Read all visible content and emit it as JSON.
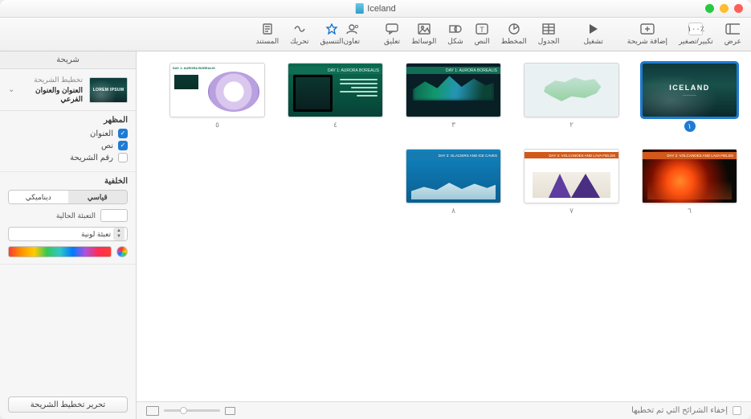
{
  "document": {
    "title": "Iceland"
  },
  "toolbar": {
    "view": "عرض",
    "zoom": "تكبير/تصغير",
    "zoom_value": "٪١٠٠",
    "add_slide": "إضافة شريحة",
    "play": "تشغيل",
    "table": "الجدول",
    "chart": "المخطط",
    "text": "النص",
    "shape": "شكل",
    "media": "الوسائط",
    "comment": "تعليق",
    "collaborate": "تعاون",
    "format": "التنسيق",
    "animate": "تحريك",
    "document_tab": "المستند"
  },
  "slides": [
    {
      "num": "١",
      "title": "ICELAND",
      "variant": "iceland",
      "selected": true
    },
    {
      "num": "٢",
      "variant": "map"
    },
    {
      "num": "٣",
      "title": "DAY 1: AURORA BOREALIS",
      "variant": "aurora"
    },
    {
      "num": "٤",
      "title": "DAY 1: AURORA BOREALIS",
      "variant": "aurora-panel"
    },
    {
      "num": "٥",
      "title": "DAY 1: AURORA BOREALIS",
      "variant": "diagram"
    },
    {
      "num": "٦",
      "title": "DAY 2: VOLCANOES AND LAVA FIELDS",
      "variant": "volcano"
    },
    {
      "num": "٧",
      "title": "DAY 2: VOLCANOES AND LAVA FIELDS",
      "variant": "volcano-map"
    },
    {
      "num": "٨",
      "title": "DAY 3: GLACIERS AND ICE CAVES",
      "variant": "glacier"
    }
  ],
  "inspector": {
    "tab": "شريحة",
    "layout_label": "تخطيط الشريحة",
    "layout_name": "العنوان والعنوان الفرعي",
    "layout_thumb_text": "LOREM IPSUM",
    "appearance": {
      "title": "المظهر",
      "title_chk": "العنوان",
      "body_chk": "نص",
      "slide_number_chk": "رقم الشريحة"
    },
    "background": {
      "title": "الخلفية",
      "standard": "قياسي",
      "dynamic": "ديناميكي",
      "current_fill": "التعبئة الحالية",
      "color_fill": "تعبئة لونية"
    },
    "edit_layout": "تحرير تخطيط الشريحة"
  },
  "footer": {
    "hide_skipped": "إخفاء الشرائح التي تم تخطيها"
  }
}
